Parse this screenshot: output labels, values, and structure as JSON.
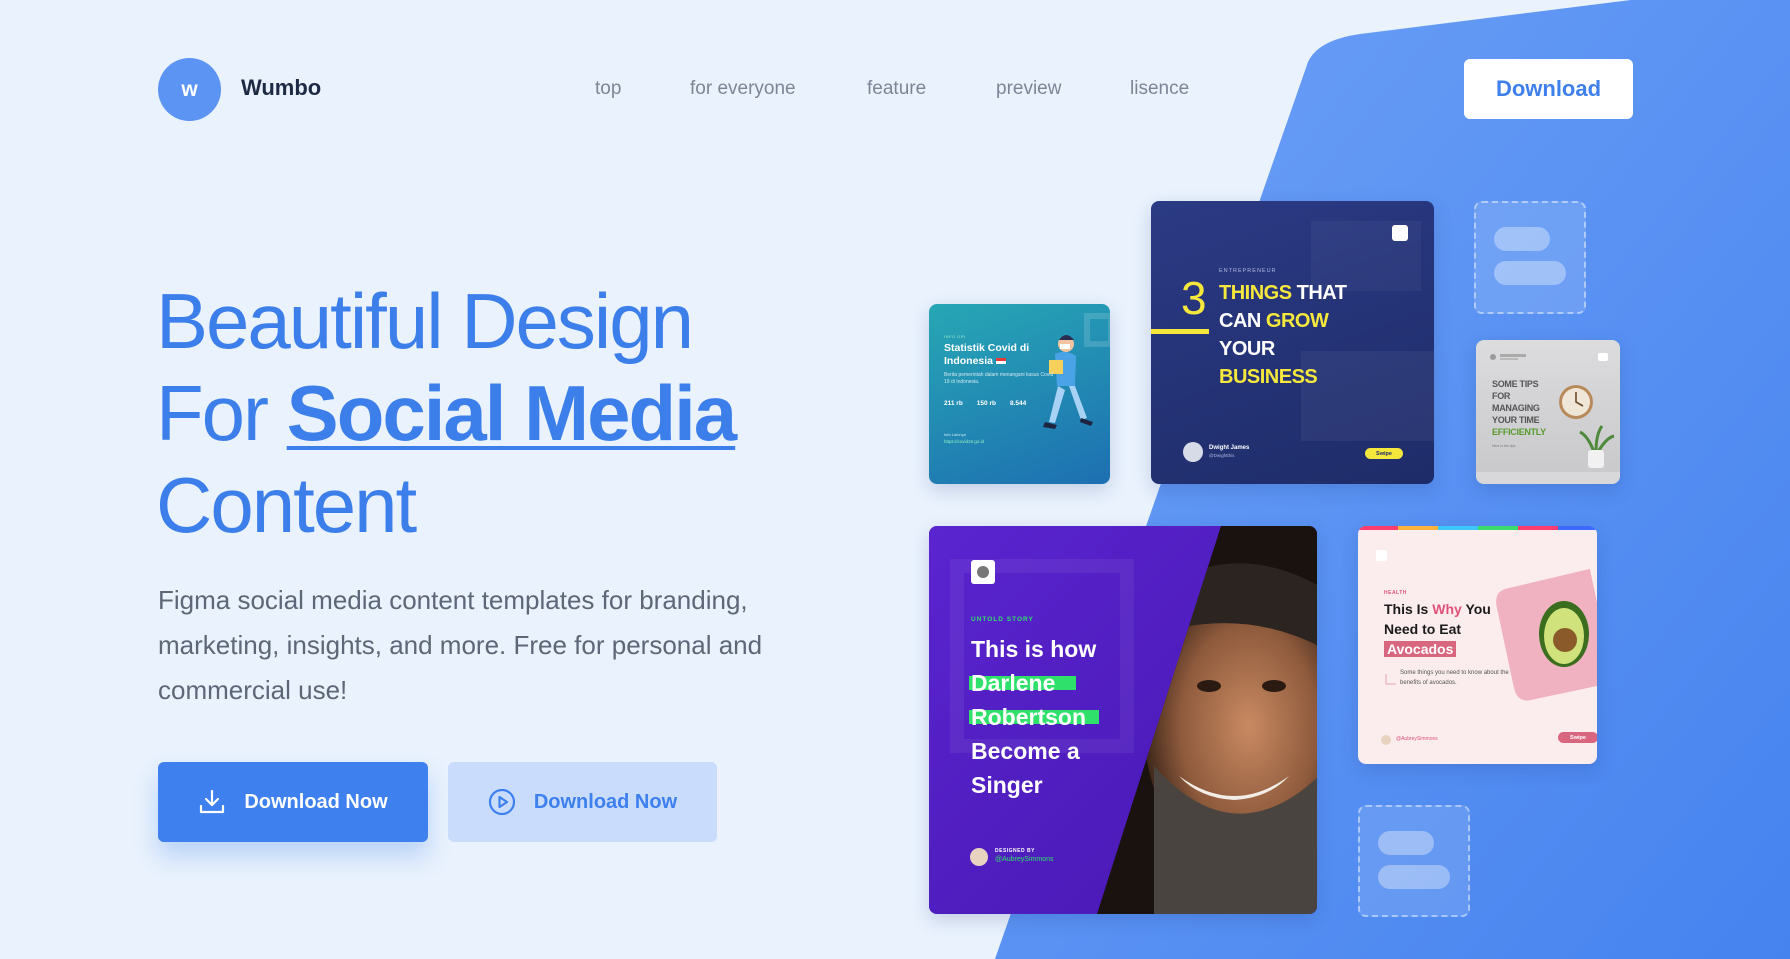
{
  "brand": {
    "logo_letter": "w",
    "name": "Wumbo"
  },
  "nav": {
    "items": [
      "top",
      "for everyone",
      "feature",
      "preview",
      "lisence"
    ]
  },
  "header": {
    "download_label": "Download"
  },
  "hero": {
    "line1": "Beautiful Design",
    "line2_prefix": "For",
    "line2_highlight": "Social Media",
    "line3": "Content",
    "description": "Figma social media content templates for branding, marketing, insights, and more. Free for personal and commercial use!",
    "primary_button": "Download Now",
    "secondary_button": "Download Now",
    "primary_icon": "download-icon",
    "secondary_icon": "play-circle-icon"
  },
  "cards": {
    "covid": {
      "tag": "INFO GRI",
      "title": "Statistik Covid di Indonesia",
      "body": "Berita pemerintah dalam menangani kasus Covid 19 di Indonesia.",
      "stats": [
        "211 rb",
        "150 rb",
        "8.544"
      ],
      "link_label": "Info Lainnya",
      "link": "https://covid19.go.id"
    },
    "business": {
      "tag": "ENTREPRENEUR",
      "number": "3",
      "line1a": "THINGS",
      "line1b": "THAT",
      "line2a": "CAN",
      "line2b": "GROW",
      "line3": "YOUR",
      "line4": "BUSINESS",
      "author": "Dwight James",
      "handle": "@Dwightthis",
      "swipe": "Swipe"
    },
    "tips": {
      "line1": "SOME TIPS",
      "line2": "FOR",
      "line3": "MANAGING",
      "line4": "YOUR TIME",
      "line5": "EFFICIENTLY",
      "footer": "Here is the tips"
    },
    "singer": {
      "tag": "UNTOLD STORY",
      "line1": "This is how",
      "line2": "Darlene",
      "line3": "Robertson",
      "line4": "Become a",
      "line5": "Singer",
      "designed_by": "DESIGNED BY",
      "handle": "@AubreySimmons"
    },
    "health": {
      "tag": "HEALTH",
      "line1a": "This Is",
      "line1b": "Why",
      "line1c": "You",
      "line2": "Need to Eat",
      "line3": "Avocados",
      "body": "Some things you need to know about the benefits of avocados.",
      "handle": "@AubreySimmons",
      "swipe": "Swipe"
    }
  },
  "colors": {
    "background": "#e9f2fd",
    "accent": "#3d80ee",
    "blue_panel": "#5a92f5",
    "text_dark": "#1e2a44",
    "text_muted": "#5d6778"
  }
}
